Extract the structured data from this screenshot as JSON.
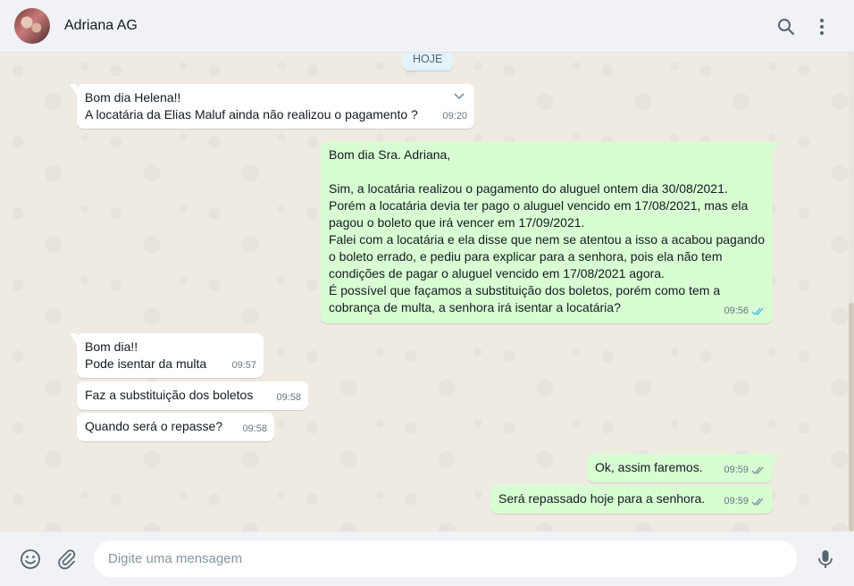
{
  "header": {
    "contact_name": "Adriana AG",
    "icons": [
      "search-icon",
      "menu-icon"
    ]
  },
  "chat": {
    "date_chip": "HOJE",
    "messages": [
      {
        "direction": "in",
        "text": "Bom dia Helena!!\nA locatária da Elias Maluf ainda não realizou o pagamento ?",
        "time": "09:20"
      },
      {
        "direction": "out",
        "text": "Bom dia Sra. Adriana,\n\nSim, a locatária realizou o pagamento do aluguel ontem dia 30/08/2021.\nPorém a locatária devia ter pago o aluguel vencido em 17/08/2021, mas ela\npagou o boleto que irá vencer em 17/09/2021.\nFalei com a locatária e ela disse que nem se atentou a isso a acabou pagando\no boleto errado, e pediu para explicar para a senhora, pois ela não tem\ncondições de pagar o aluguel vencido em 17/08/2021 agora.\nÉ possível que façamos a substituição dos boletos, porém como tem a\ncobrança de multa, a senhora irá isentar a locatária?",
        "time": "09:56",
        "status": "read"
      },
      {
        "direction": "in",
        "text": "Bom dia!!\nPode isentar da multa",
        "time": "09:57"
      },
      {
        "direction": "in",
        "text": "Faz a substituição dos boletos",
        "time": "09:58"
      },
      {
        "direction": "in",
        "text": "Quando será o repasse?",
        "time": "09:58"
      },
      {
        "direction": "out",
        "text": "Ok, assim faremos.",
        "time": "09:59",
        "status": "delivered"
      },
      {
        "direction": "out",
        "text": "Será repassado hoje para a senhora.",
        "time": "09:59",
        "status": "delivered"
      }
    ]
  },
  "composer": {
    "placeholder": "Digite uma mensagem",
    "value": "",
    "icons": [
      "emoji-icon",
      "attach-icon",
      "microphone-icon"
    ]
  },
  "colors": {
    "incoming_bubble": "#ffffff",
    "outgoing_bubble": "#d9fdd3",
    "read_tick": "#53bdeb",
    "delivered_tick": "#8696a0",
    "chat_background": "#efeae2"
  }
}
